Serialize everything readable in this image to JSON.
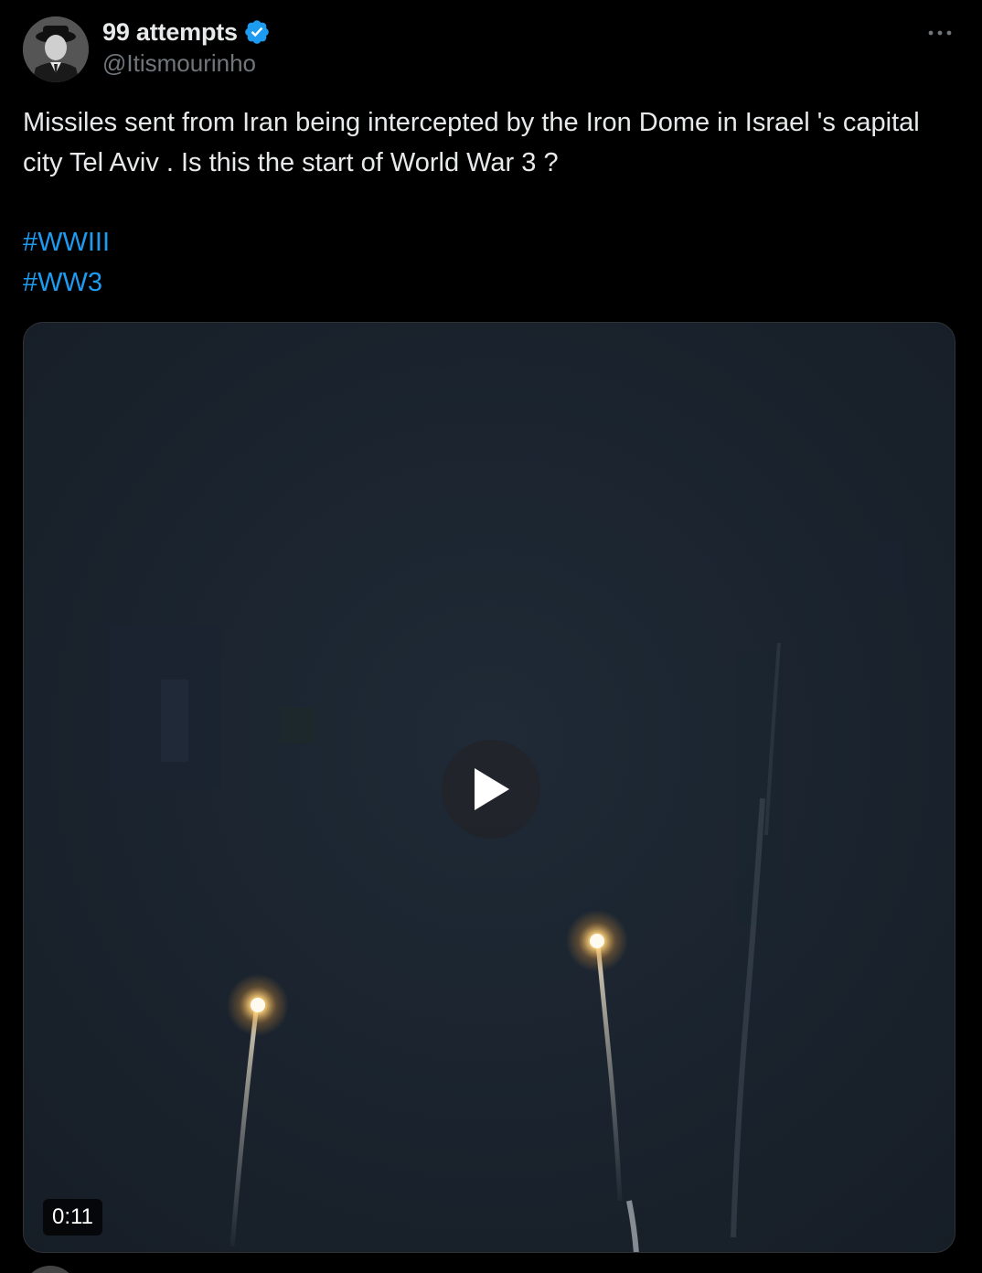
{
  "tweet": {
    "author_name": "99 attempts",
    "author_handle": "@Itismourinho",
    "verified": true,
    "text": "Missiles sent from Iran being intercepted by the Iron Dome in Israel 's capital city Tel Aviv . Is this the start of World War 3 ?",
    "hashtags": [
      "#WWIII",
      "#WW3"
    ],
    "more_icon": "more-horizontal-icon",
    "verified_icon": "verified-badge-icon",
    "colors": {
      "background": "#000000",
      "text": "#e7e9ea",
      "secondary_text": "#71767b",
      "link": "#1d9bf0",
      "verified": "#1d9bf0"
    }
  },
  "media": {
    "type": "video",
    "duration": "0:11",
    "play_icon": "play-icon"
  }
}
